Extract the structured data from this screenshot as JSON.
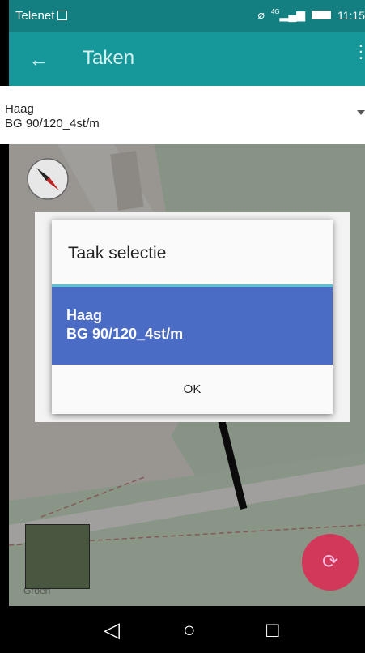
{
  "status_bar": {
    "carrier": "Telenet",
    "time": "11:15",
    "network": "4G"
  },
  "app_bar": {
    "title": "Taken",
    "back_glyph": "←",
    "menu_glyph": "⋮"
  },
  "task_header": {
    "line1": "Haag",
    "line2": "BG 90/120_4st/m"
  },
  "map": {
    "street_label": "Groen"
  },
  "dialog": {
    "title": "Taak selectie",
    "item_line1": "Haag",
    "item_line2": "BG 90/120_4st/m",
    "ok_label": "OK"
  },
  "fab": {
    "icon": "refresh-icon",
    "glyph": "⟳"
  },
  "nav": {
    "back_glyph": "◁",
    "home_glyph": "○",
    "recent_glyph": "□"
  },
  "colors": {
    "status": "#137f80",
    "appbar": "#16989a",
    "selected": "#4b6cc4",
    "accent": "#5bc4d4",
    "fab": "#d2385a"
  }
}
